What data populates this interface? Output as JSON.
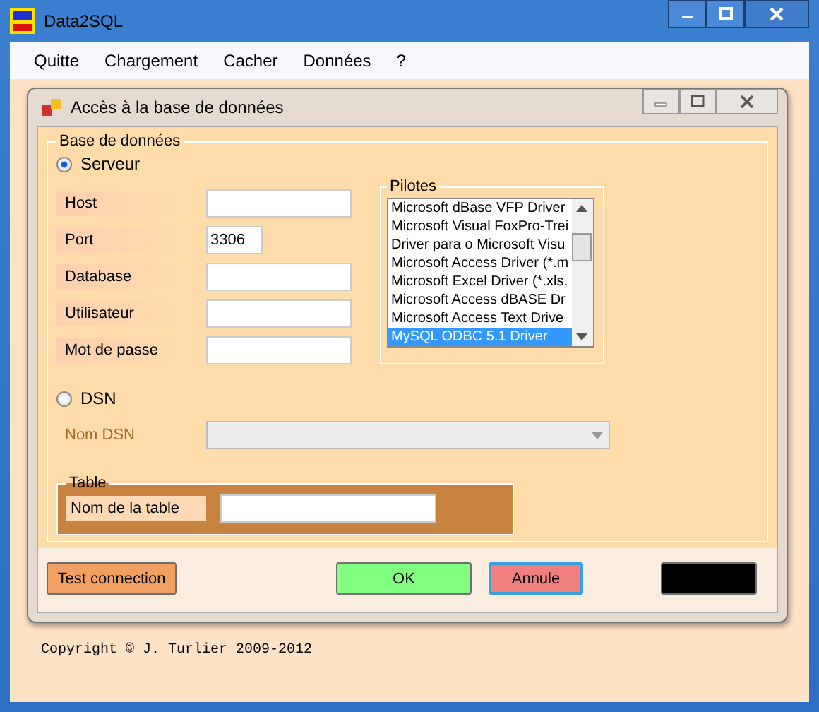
{
  "window": {
    "title": "Data2SQL"
  },
  "menu": [
    {
      "label": "Quitte"
    },
    {
      "label": "Chargement"
    },
    {
      "label": "Cacher"
    },
    {
      "label": "Données"
    },
    {
      "label": "?"
    }
  ],
  "dialog": {
    "title": "Accès à la base de données",
    "database_group": {
      "title": "Base de données",
      "server_option": {
        "label": "Serveur",
        "selected": true
      },
      "fields": [
        {
          "label": "Host",
          "kind": "text"
        },
        {
          "label": "Port",
          "value": "3306",
          "kind": "number"
        },
        {
          "label": "Database",
          "kind": "text"
        },
        {
          "label": "Utilisateur",
          "kind": "text"
        },
        {
          "label": "Mot de passe",
          "kind": "text"
        }
      ],
      "drivers": {
        "title": "Pilotes",
        "items": [
          {
            "label": "Microsoft dBase VFP Driver",
            "selected": false
          },
          {
            "label": "Microsoft Visual FoxPro-Trei",
            "selected": false
          },
          {
            "label": "Driver para o Microsoft Visu",
            "selected": false
          },
          {
            "label": "Microsoft Access Driver (*.m",
            "selected": false
          },
          {
            "label": "Microsoft Excel Driver (*.xls,",
            "selected": false
          },
          {
            "label": "Microsoft Access dBASE Dr",
            "selected": false
          },
          {
            "label": "Microsoft Access Text Drive",
            "selected": false
          },
          {
            "label": "MySQL ODBC 5.1 Driver",
            "selected": true
          }
        ]
      },
      "dsn_option": {
        "label": "DSN",
        "selected": false
      },
      "dsn_field": {
        "label": "Nom DSN",
        "disabled": true
      }
    },
    "table_group": {
      "title": "Table",
      "field": {
        "label": "Nom de la table"
      }
    },
    "buttons": [
      {
        "label": "Test connection",
        "color": "#f0a060",
        "focused": false
      },
      {
        "label": "OK",
        "color": "#80ff80",
        "focused": false
      },
      {
        "label": "Annule",
        "color": "#f08080",
        "focused": true
      },
      {
        "color": "#000000",
        "focused": false
      }
    ]
  },
  "copyright": "Copyright ©  J. Turlier 2009-2012"
}
